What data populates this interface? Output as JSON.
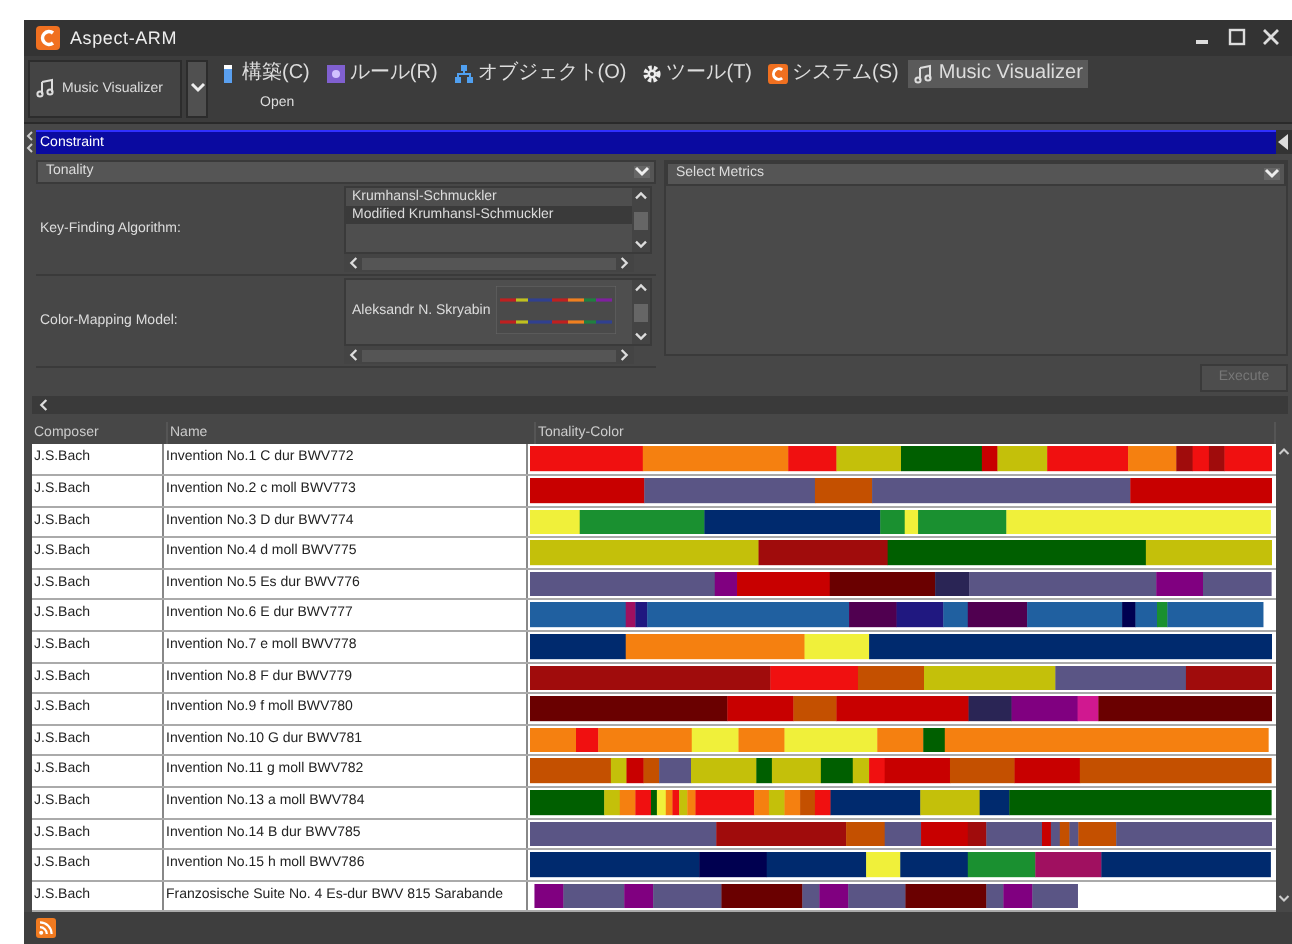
{
  "window": {
    "title": "Aspect-ARM"
  },
  "toolbar": {
    "module_select": {
      "value": "Music Visualizer"
    },
    "tabs": [
      {
        "label": "構築(C)",
        "selected": false
      },
      {
        "label": "ルール(R)",
        "selected": false
      },
      {
        "label": "オブジェクト(O)",
        "selected": false
      },
      {
        "label": "ツール(T)",
        "selected": false
      },
      {
        "label": "システム(S)",
        "selected": false
      },
      {
        "label": "Music Visualizer",
        "selected": true
      }
    ],
    "actions": [
      "Open"
    ]
  },
  "constraint": {
    "title": "Constraint",
    "tonality": {
      "title": "Tonality",
      "key_finding": {
        "label": "Key-Finding Algorithm:",
        "items": [
          {
            "label": "Krumhansl-Schmuckler",
            "selected": false
          },
          {
            "label": "Modified Krumhansl-Schmuckler",
            "selected": true
          }
        ]
      },
      "color_mapping": {
        "label": "Color-Mapping Model:",
        "items": [
          {
            "label": "Aleksandr N. Skryabin",
            "selected": false
          }
        ]
      }
    },
    "metrics": {
      "title": "Select Metrics"
    },
    "execute": {
      "label": "Execute",
      "disabled": true
    }
  },
  "table": {
    "columns": [
      "Composer",
      "Name",
      "Tonality-Color"
    ],
    "rows": [
      {
        "composer": "J.S.Bach",
        "name": "Invention No.1 C dur BWV772"
      },
      {
        "composer": "J.S.Bach",
        "name": "Invention No.2 c moll BWV773"
      },
      {
        "composer": "J.S.Bach",
        "name": "Invention No.3 D dur BWV774"
      },
      {
        "composer": "J.S.Bach",
        "name": "Invention No.4 d moll BWV775"
      },
      {
        "composer": "J.S.Bach",
        "name": "Invention No.5 Es dur BWV776"
      },
      {
        "composer": "J.S.Bach",
        "name": "Invention No.6 E dur BWV777"
      },
      {
        "composer": "J.S.Bach",
        "name": "Invention No.7 e moll BWV778"
      },
      {
        "composer": "J.S.Bach",
        "name": "Invention No.8 F dur BWV779"
      },
      {
        "composer": "J.S.Bach",
        "name": "Invention No.9 f moll BWV780"
      },
      {
        "composer": "J.S.Bach",
        "name": "Invention No.10 G dur BWV781"
      },
      {
        "composer": "J.S.Bach",
        "name": "Invention No.11 g moll BWV782"
      },
      {
        "composer": "J.S.Bach",
        "name": "Invention No.13 a moll BWV784"
      },
      {
        "composer": "J.S.Bach",
        "name": "Invention No.14 B dur BWV785"
      },
      {
        "composer": "J.S.Bach",
        "name": "Invention No.15 h moll BWV786"
      },
      {
        "composer": "J.S.Bach",
        "name": "Franzosische Suite No. 4 Es-dur BWV 815 Sarabande"
      }
    ]
  }
}
